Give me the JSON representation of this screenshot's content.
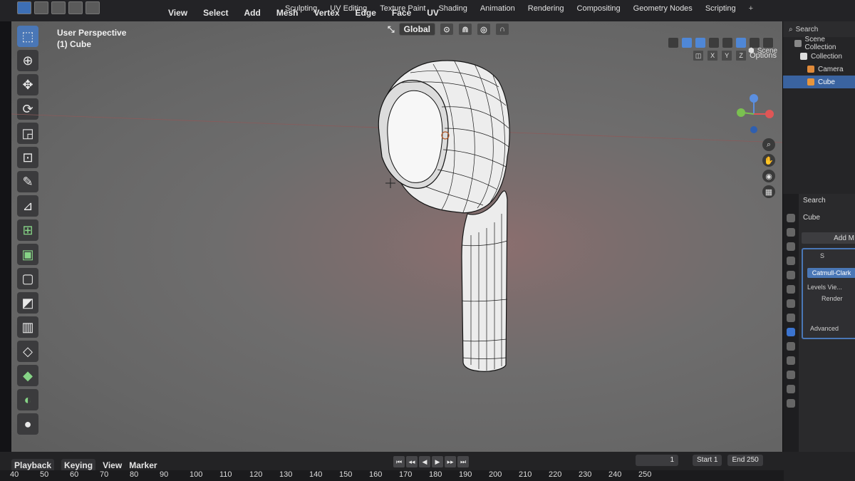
{
  "header": {
    "menu": [
      "View",
      "Select",
      "Add",
      "Mesh",
      "Vertex",
      "Edge",
      "Face",
      "UV"
    ],
    "tabs": [
      "Sculpting",
      "UV Editing",
      "Texture Paint",
      "Shading",
      "Animation",
      "Rendering",
      "Compositing",
      "Geometry Nodes",
      "Scripting"
    ],
    "tab_plus": "+",
    "scene_label": "Scene"
  },
  "viewport": {
    "perspective": "User Perspective",
    "object": "(1) Cube",
    "transform_orientation": "Global",
    "options_label": "Options",
    "axis_x": "X",
    "axis_y": "Y",
    "axis_z": "Z"
  },
  "outliner": {
    "search_placeholder": "Search",
    "scene_collection": "Scene Collection",
    "collection": "Collection",
    "camera": "Camera",
    "cube": "Cube"
  },
  "properties": {
    "search_placeholder": "Search",
    "object_name": "Cube",
    "add_modifier": "Add M",
    "modifier_short": "S",
    "subdiv_type": "Catmull-Clark",
    "levels_viewport": "Levels Vie...",
    "render": "Render",
    "advanced": "Advanced"
  },
  "timeline": {
    "playback": "Playback",
    "keying": "Keying",
    "view": "View",
    "marker": "Marker",
    "current_frame": "1",
    "start_label": "Start",
    "start_value": "1",
    "end_label": "End",
    "end_value": "250",
    "ruler_ticks": [
      "40",
      "50",
      "60",
      "70",
      "80",
      "90",
      "100",
      "110",
      "120",
      "130",
      "140",
      "150",
      "160",
      "170",
      "180",
      "190",
      "200",
      "210",
      "220",
      "230",
      "240",
      "250"
    ]
  },
  "colors": {
    "accent": "#4a77b6",
    "viewport_bg": "#6b6a6a",
    "mesh_fill": "#f2f2f2",
    "wire": "#1a1a1a"
  }
}
